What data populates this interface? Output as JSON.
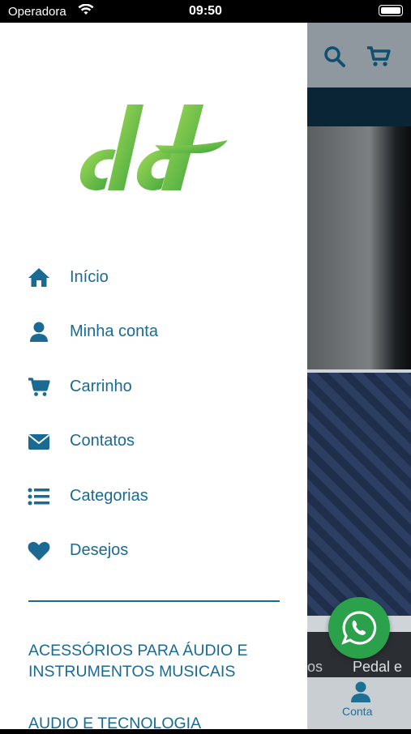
{
  "status_bar": {
    "carrier": "Operadora",
    "time": "09:50"
  },
  "menu": {
    "items": [
      {
        "label": "Início",
        "icon": "home-icon"
      },
      {
        "label": "Minha conta",
        "icon": "user-icon"
      },
      {
        "label": "Carrinho",
        "icon": "cart-icon"
      },
      {
        "label": "Contatos",
        "icon": "envelope-icon"
      },
      {
        "label": "Categorias",
        "icon": "list-icon"
      },
      {
        "label": "Desejos",
        "icon": "heart-icon"
      }
    ]
  },
  "categories": [
    "ACESSÓRIOS PARA ÁUDIO E INSTRUMENTOS MUSICAIS",
    "AUDIO E TECNOLOGIA"
  ],
  "background": {
    "tile_texts": [
      "os",
      "Pedal e"
    ],
    "tab_label": "Conta"
  },
  "colors": {
    "accent": "#1a6a93",
    "whatsapp": "#2aa14a",
    "logo_green": "#6cc24a"
  }
}
